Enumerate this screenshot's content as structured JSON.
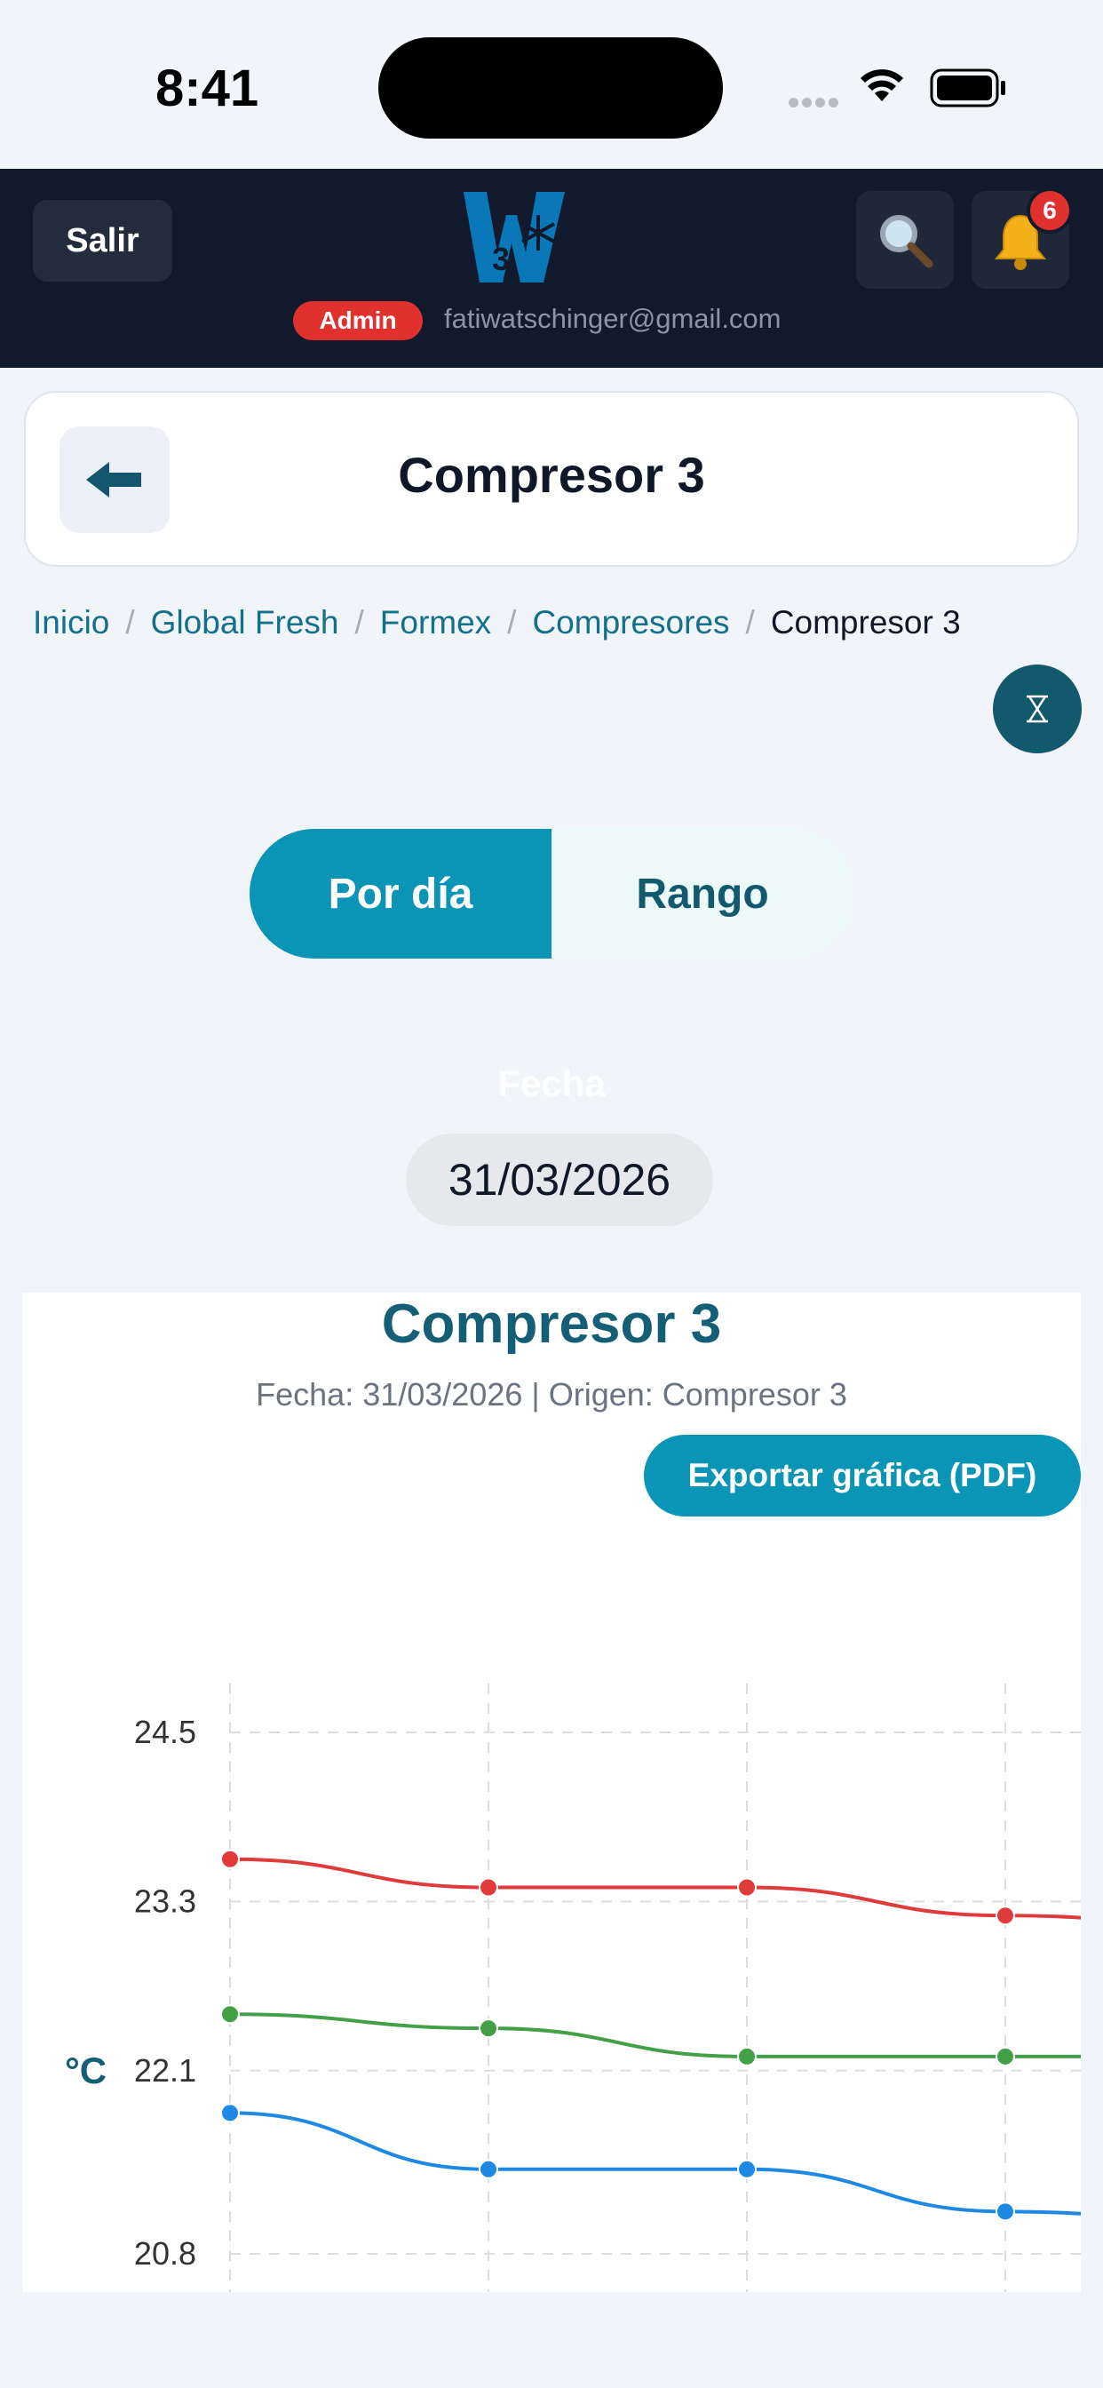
{
  "status_bar": {
    "time": "8:41",
    "wifi_icon": "wifi-icon",
    "battery_icon": "battery-icon"
  },
  "header": {
    "logout_label": "Salir",
    "logo_icon": "w3-snowflake-logo",
    "search_icon": "search-icon",
    "notifications_icon": "bell-icon",
    "notifications_count": "6",
    "role_badge": "Admin",
    "user_email": "fatiwatschinger@gmail.com"
  },
  "title_card": {
    "back_icon": "arrow-left-icon",
    "title": "Compresor 3"
  },
  "breadcrumb": {
    "items": [
      "Inicio",
      "Global Fresh",
      "Formex",
      "Compresores"
    ],
    "current": "Compresor 3",
    "separator": "/"
  },
  "filter_button_icon": "hourglass-icon",
  "mode_toggle": {
    "options": [
      "Por día",
      "Rango"
    ],
    "selected": "Por día"
  },
  "date_filter": {
    "label": "Fecha",
    "value": "31/03/2026"
  },
  "chart_card": {
    "title": "Compresor 3",
    "subtitle": "Fecha: 31/03/2026 | Origen: Compresor 3",
    "export_label": "Exportar gráfica (PDF)"
  },
  "colors": {
    "accent": "#0a94b5",
    "header_bg": "#111a2c",
    "badge_red": "#e0312f",
    "series_red": "#e03a3a",
    "series_green": "#43a047",
    "series_blue": "#1e88e5"
  },
  "chart_data": {
    "type": "line",
    "ylabel": "°C",
    "yticks": [
      20.8,
      22.1,
      23.3,
      24.5
    ],
    "ylim": [
      20.6,
      24.7
    ],
    "x": [
      1,
      2,
      3,
      4,
      5
    ],
    "grid": true,
    "series": [
      {
        "color": "#e03a3a",
        "values": [
          23.6,
          23.4,
          23.4,
          23.2,
          23.1
        ]
      },
      {
        "color": "#43a047",
        "values": [
          22.5,
          22.4,
          22.2,
          22.2,
          22.2
        ]
      },
      {
        "color": "#1e88e5",
        "values": [
          21.8,
          21.4,
          21.4,
          21.1,
          21.0
        ]
      }
    ]
  }
}
